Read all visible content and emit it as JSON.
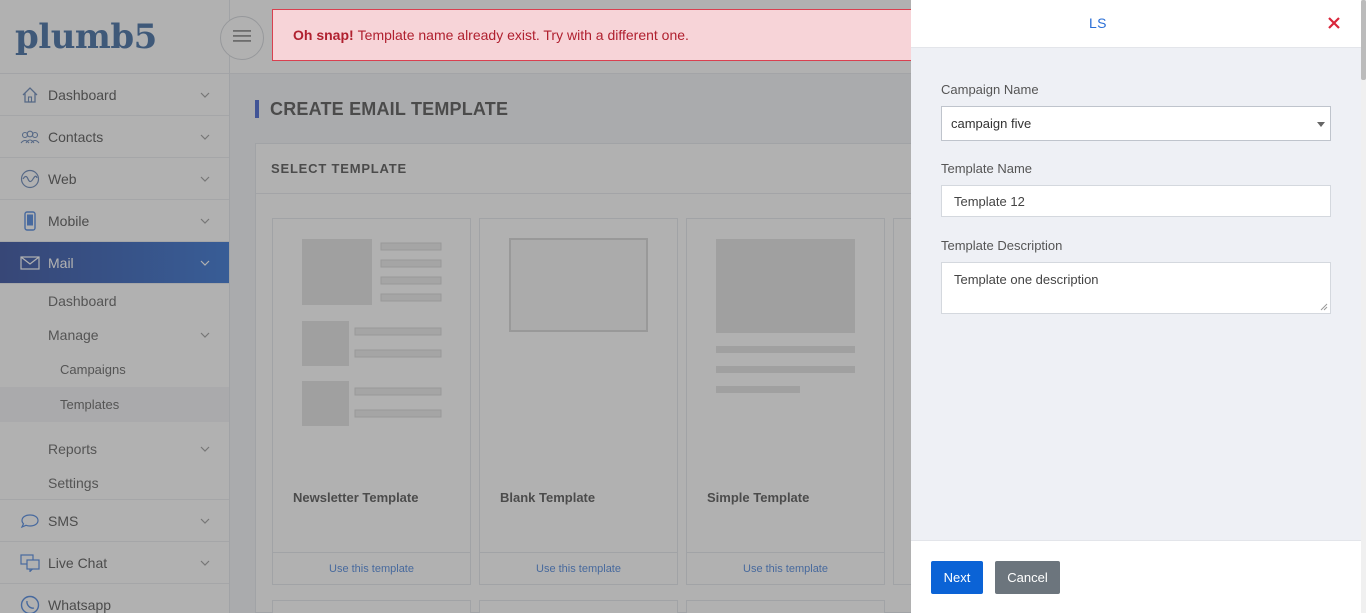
{
  "brand": {
    "logo_text": "plumb5"
  },
  "sidebar": {
    "items": [
      {
        "label": "Dashboard",
        "icon": "home-icon"
      },
      {
        "label": "Contacts",
        "icon": "contacts-icon"
      },
      {
        "label": "Web",
        "icon": "web-icon"
      },
      {
        "label": "Mobile",
        "icon": "mobile-icon"
      },
      {
        "label": "Mail",
        "icon": "mail-icon",
        "active": true
      },
      {
        "label": "SMS",
        "icon": "sms-icon"
      },
      {
        "label": "Live Chat",
        "icon": "live-chat-icon"
      },
      {
        "label": "Whatsapp",
        "icon": "whatsapp-icon"
      }
    ],
    "mail_sub": {
      "dashboard": "Dashboard",
      "manage": "Manage",
      "campaigns": "Campaigns",
      "templates": "Templates",
      "reports": "Reports",
      "settings": "Settings"
    }
  },
  "main": {
    "page_title": "CREATE EMAIL TEMPLATE",
    "panel_title": "SELECT TEMPLATE",
    "templates": [
      {
        "name": "Newsletter Template",
        "action": "Use this template"
      },
      {
        "name": "Blank Template",
        "action": "Use this template"
      },
      {
        "name": "Simple Template",
        "action": "Use this template"
      }
    ]
  },
  "alert": {
    "strong": "Oh snap!",
    "message": "Template name already exist. Try with a different one.",
    "close": "×"
  },
  "drawer": {
    "title_fragment": "LS",
    "campaign_label": "Campaign Name",
    "campaign_value": "campaign five",
    "template_name_label": "Template Name",
    "template_name_value": "Template 12",
    "description_label": "Template Description",
    "description_value": "Template one description",
    "next_label": "Next",
    "cancel_label": "Cancel"
  },
  "colors": {
    "accent": "#0b63d6",
    "alert_bg": "#f7d4d8",
    "alert_text": "#b0202f",
    "active_nav_start": "#0a2a8a",
    "active_nav_end": "#0c56c9",
    "close_red": "#d9263b"
  }
}
